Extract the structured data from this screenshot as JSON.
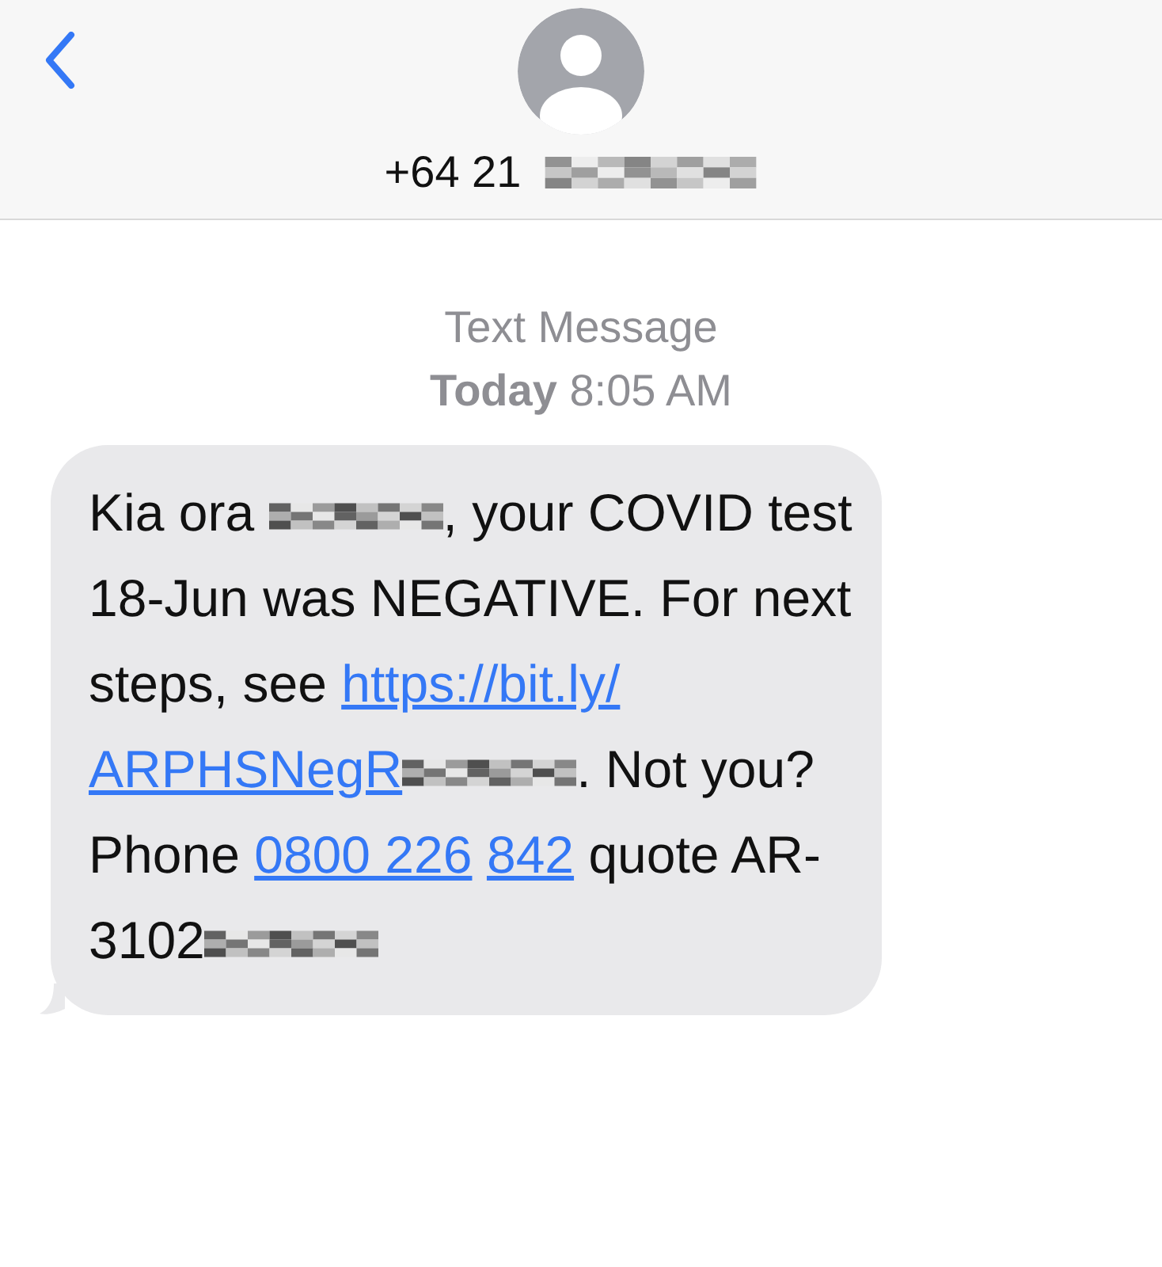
{
  "header": {
    "contact_number": "+64 21",
    "number_redacted": true
  },
  "meta": {
    "label": "Text Message",
    "day": "Today",
    "time": "8:05 AM"
  },
  "message": {
    "segments": [
      {
        "kind": "text",
        "text": "Kia ora "
      },
      {
        "kind": "redacted"
      },
      {
        "kind": "text",
        "text": ", your COVID test 18-Jun was NEGATIVE. For next steps, see "
      },
      {
        "kind": "link",
        "text": "https://bit.ly/",
        "space_after": true
      },
      {
        "kind": "link",
        "text": "ARPHSNegR"
      },
      {
        "kind": "redacted"
      },
      {
        "kind": "text",
        "text": ". Not you? Phone "
      },
      {
        "kind": "link",
        "text": "0800 226",
        "space_after": true
      },
      {
        "kind": "link",
        "text": "842"
      },
      {
        "kind": "text",
        "text": " quote AR-3102"
      },
      {
        "kind": "redacted"
      }
    ]
  }
}
